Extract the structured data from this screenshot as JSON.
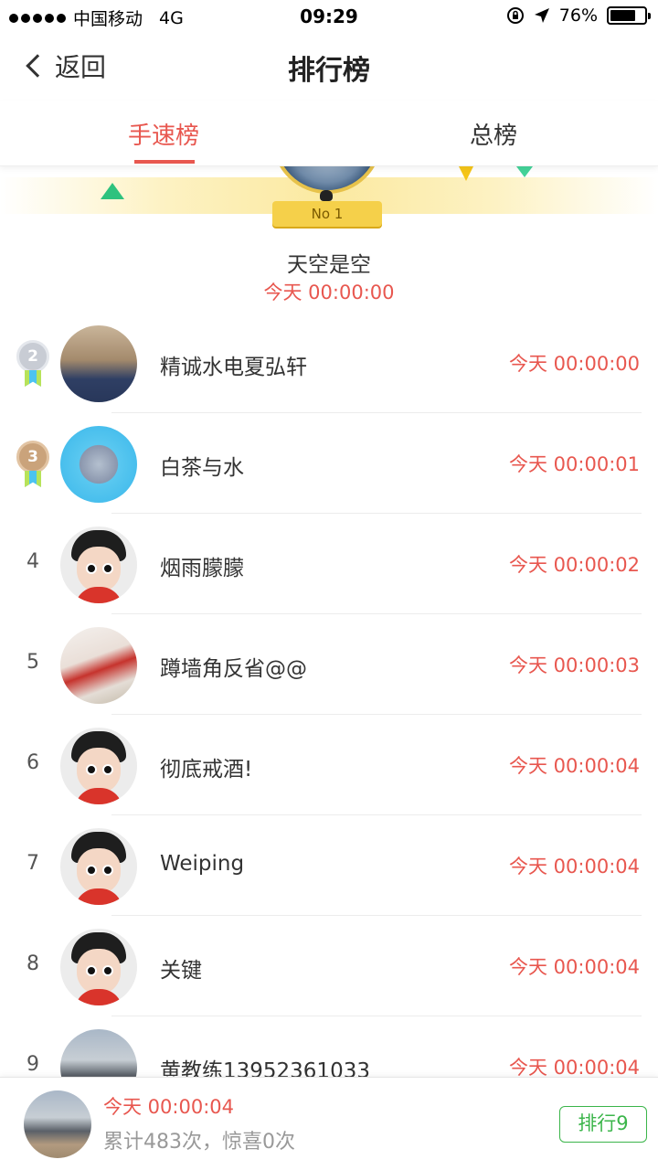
{
  "status_bar": {
    "carrier": "中国移动",
    "network": "4G",
    "time": "09:29",
    "battery": "76%",
    "battery_level": 0.76,
    "icons": [
      "signal-dots-icon",
      "rotation-lock-icon",
      "location-arrow-icon",
      "battery-icon"
    ]
  },
  "nav": {
    "back_label": "返回",
    "title": "排行榜"
  },
  "tabs": [
    {
      "label": "手速榜",
      "active": true
    },
    {
      "label": "总榜",
      "active": false
    }
  ],
  "champion": {
    "badge": "No 1",
    "name": "天空是空",
    "time": "今天 00:00:00"
  },
  "rankings": [
    {
      "rank": "2",
      "name": "精诚水电夏弘轩",
      "time": "今天 00:00:00",
      "avatar": "photo-man",
      "badge": "silver-medal-icon"
    },
    {
      "rank": "3",
      "name": "白茶与水",
      "time": "今天 00:00:01",
      "avatar": "photo-bunny",
      "badge": "bronze-medal-icon"
    },
    {
      "rank": "4",
      "name": "烟雨朦朦",
      "time": "今天 00:00:02",
      "avatar": "default"
    },
    {
      "rank": "5",
      "name": "蹲墙角反省@@",
      "time": "今天 00:00:03",
      "avatar": "photo-red"
    },
    {
      "rank": "6",
      "name": "彻底戒酒!",
      "time": "今天 00:00:04",
      "avatar": "default"
    },
    {
      "rank": "7",
      "name": "Weiping",
      "time": "今天 00:00:04",
      "avatar": "default"
    },
    {
      "rank": "8",
      "name": "关键",
      "time": "今天 00:00:04",
      "avatar": "default"
    },
    {
      "rank": "9",
      "name": "黄教练13952361033",
      "time": "今天 00:00:04",
      "avatar": "photo-beach"
    }
  ],
  "me": {
    "time": "今天 00:00:04",
    "stats": "累计483次，惊喜0次",
    "rank_button": "排行9"
  },
  "colors": {
    "accent": "#e8574f",
    "green": "#3bb54a"
  }
}
